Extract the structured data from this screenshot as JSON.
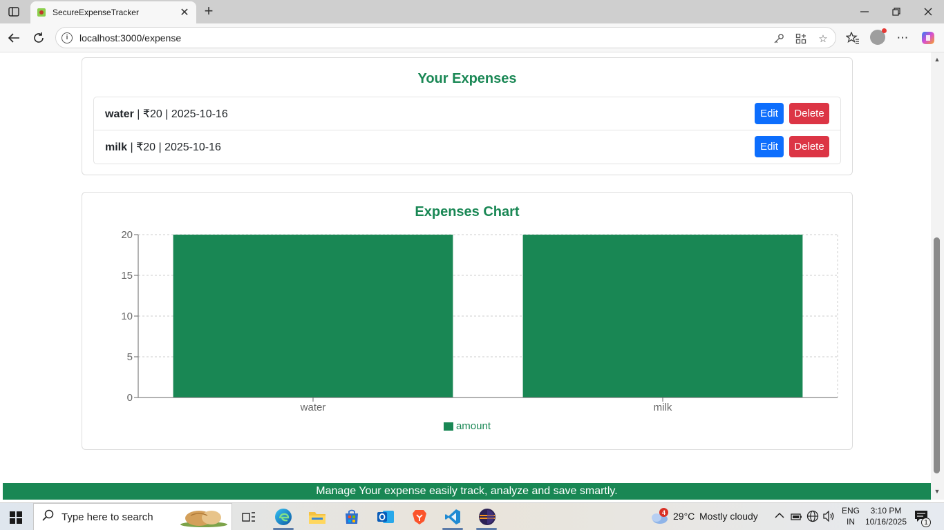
{
  "browser": {
    "tab_title": "SecureExpenseTracker",
    "url": "localhost:3000/expense"
  },
  "expenses_card": {
    "title": "Your Expenses",
    "items": [
      {
        "name": "water",
        "details": " | ₹20 | 2025-10-16",
        "edit_label": "Edit",
        "delete_label": "Delete"
      },
      {
        "name": "milk",
        "details": " | ₹20 | 2025-10-16",
        "edit_label": "Edit",
        "delete_label": "Delete"
      }
    ]
  },
  "chart_card": {
    "title": "Expenses Chart",
    "legend_label": "amount"
  },
  "chart_data": {
    "type": "bar",
    "categories": [
      "water",
      "milk"
    ],
    "series": [
      {
        "name": "amount",
        "values": [
          20,
          20
        ],
        "color": "#198754"
      }
    ],
    "ylim": [
      0,
      20
    ],
    "yticks": [
      0,
      5,
      10,
      15,
      20
    ],
    "grid": true,
    "legend": "bottom"
  },
  "footer": {
    "text": "Manage Your expense easily track, analyze and save smartly."
  },
  "taskbar": {
    "search_placeholder": "Type here to search",
    "weather_badge": "4",
    "temperature": "29°C",
    "weather_desc": "Mostly cloudy",
    "lang_line1": "ENG",
    "lang_line2": "IN",
    "time": "3:10 PM",
    "date": "10/16/2025",
    "notification_count": "1"
  },
  "colors": {
    "accent": "#198754",
    "edit_button": "#0d6efd",
    "delete_button": "#dc3545"
  }
}
